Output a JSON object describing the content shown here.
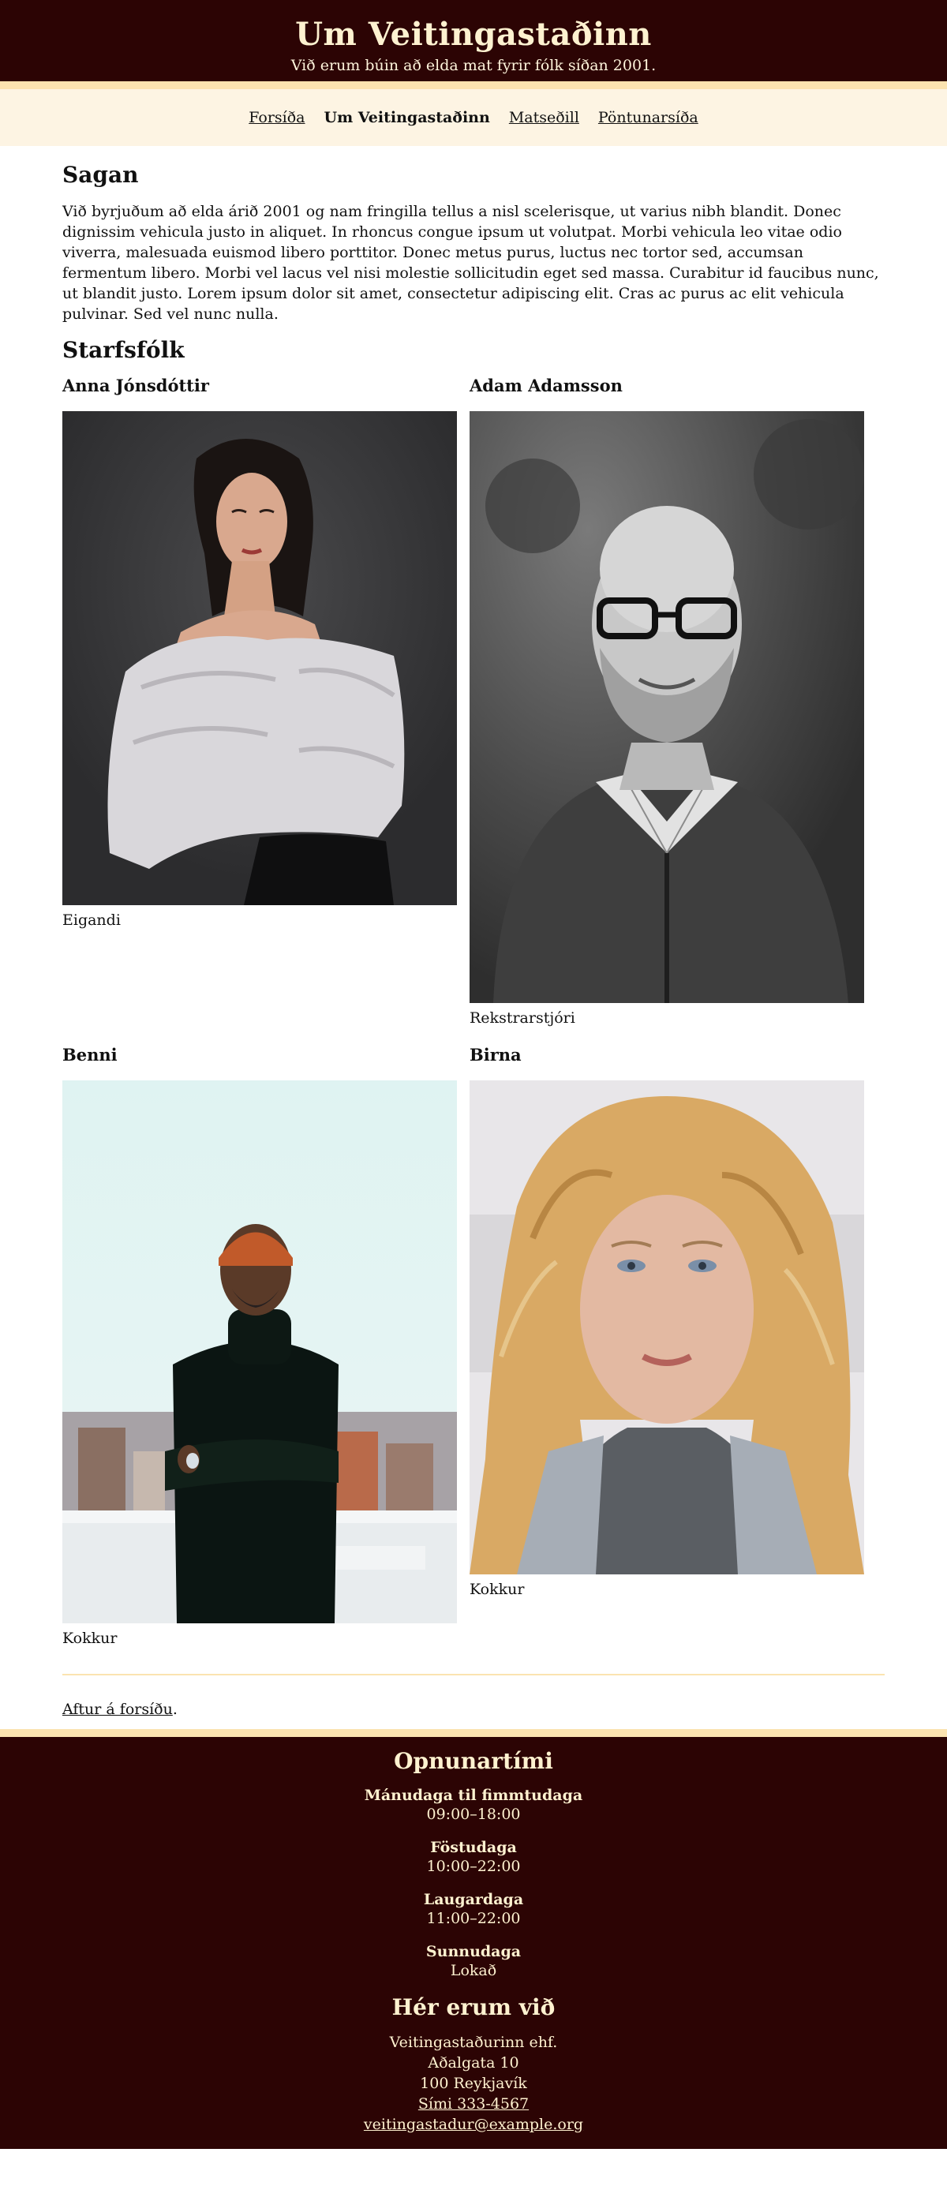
{
  "header": {
    "title": "Um Veitingastaðinn",
    "tagline": "Við erum búin að elda mat fyrir fólk síðan 2001."
  },
  "nav": {
    "items": [
      {
        "label": "Forsíða",
        "current": false
      },
      {
        "label": "Um Veitingastaðinn",
        "current": true
      },
      {
        "label": "Matseðill",
        "current": false
      },
      {
        "label": "Pöntunarsíða",
        "current": false
      }
    ]
  },
  "story": {
    "heading": "Sagan",
    "text": "Við byrjuðum að elda árið 2001 og nam fringilla tellus a nisl scelerisque, ut varius nibh blandit. Donec dignissim vehicula justo in aliquet. In rhoncus congue ipsum ut volutpat. Morbi vehicula leo vitae odio viverra, malesuada euismod libero porttitor. Donec metus purus, luctus nec tortor sed, accumsan fermentum libero. Morbi vel lacus vel nisi molestie sollicitudin eget sed massa. Curabitur id faucibus nunc, ut blandit justo. Lorem ipsum dolor sit amet, consectetur adipiscing elit. Cras ac purus ac elit vehicula pulvinar. Sed vel nunc nulla."
  },
  "staff": {
    "heading": "Starfsfólk",
    "members": [
      {
        "name": "Anna Jónsdóttir",
        "role": "Eigandi"
      },
      {
        "name": "Adam Adamsson",
        "role": "Rekstrarstjóri"
      },
      {
        "name": "Benni",
        "role": "Kokkur"
      },
      {
        "name": "Birna",
        "role": "Kokkur"
      }
    ]
  },
  "back": {
    "link_label": "Aftur á forsíðu",
    "suffix": "."
  },
  "footer": {
    "hours_heading": "Opnunartími",
    "hours": [
      {
        "day": "Mánudaga til fimmtudaga",
        "time": "09:00–18:00"
      },
      {
        "day": "Föstudaga",
        "time": "10:00–22:00"
      },
      {
        "day": "Laugardaga",
        "time": "11:00–22:00"
      },
      {
        "day": "Sunnudaga",
        "time": "Lokað"
      }
    ],
    "contact_heading": "Hér erum við",
    "company": "Veitingastaðurinn ehf.",
    "street": "Aðalgata 10",
    "city": "100 Reykjavík",
    "phone": "Sími 333-4567",
    "email": "veitingastadur@example.org"
  },
  "colors": {
    "dark_red": "#2c0404",
    "cream": "#fbe3b0",
    "nav_bg": "#fdf4e3",
    "header_text": "#fff2d0"
  }
}
